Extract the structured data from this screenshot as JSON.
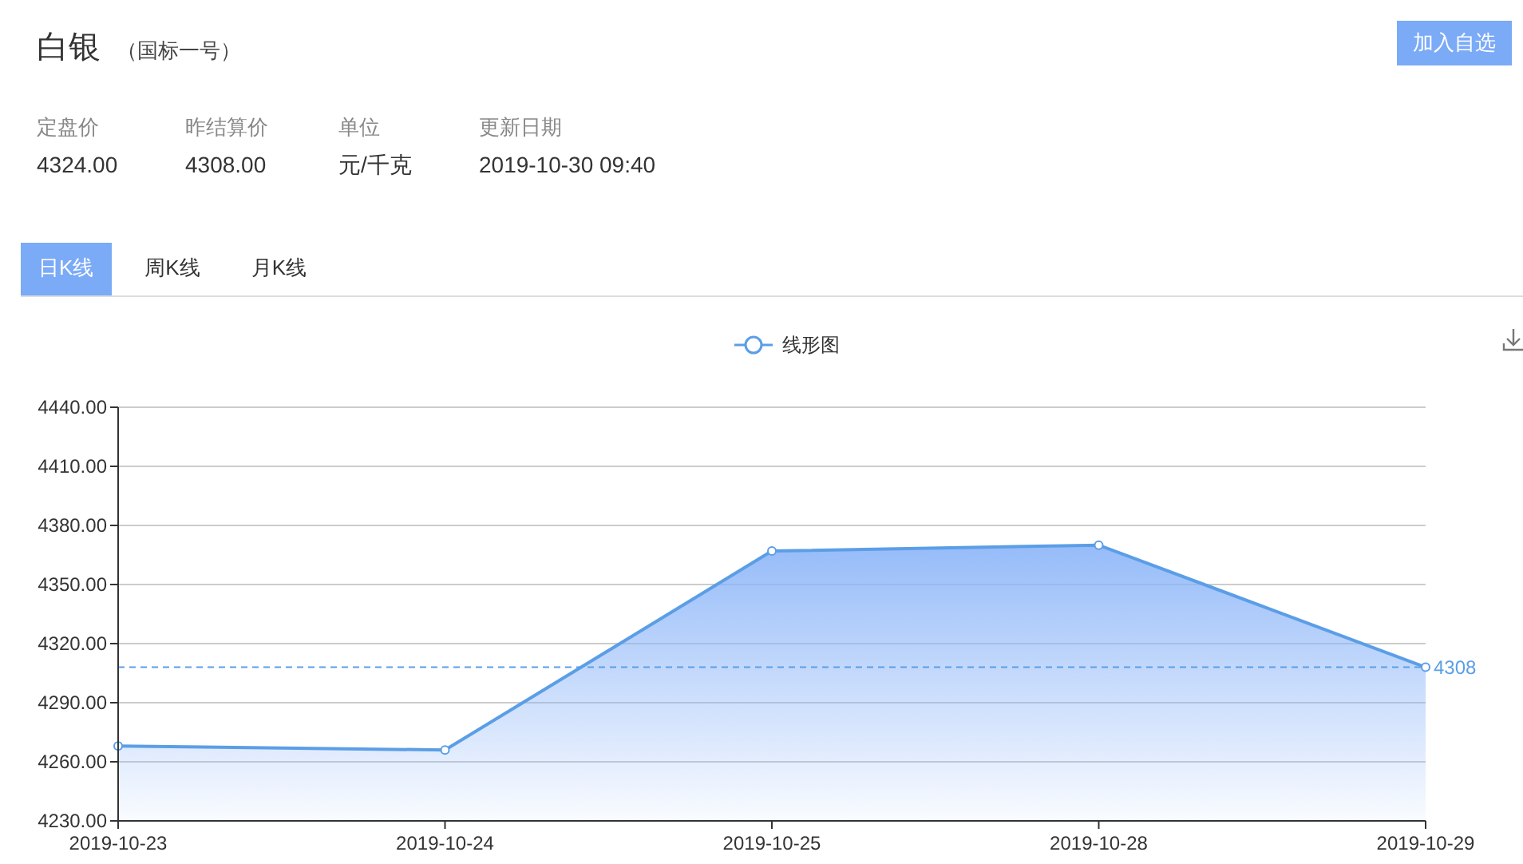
{
  "header": {
    "title": "白银",
    "subtitle": "（国标一号）",
    "add_button": "加入自选"
  },
  "info": [
    {
      "label": "定盘价",
      "value": "4324.00"
    },
    {
      "label": "昨结算价",
      "value": "4308.00"
    },
    {
      "label": "单位",
      "value": "元/千克"
    },
    {
      "label": "更新日期",
      "value": "2019-10-30 09:40"
    }
  ],
  "tabs": [
    {
      "label": "日K线",
      "selected": true
    },
    {
      "label": "周K线",
      "selected": false
    },
    {
      "label": "月K线",
      "selected": false
    }
  ],
  "chart": {
    "chart_data": {
      "type": "area",
      "categories": [
        "2019-10-23",
        "2019-10-24",
        "2019-10-25",
        "2019-10-28",
        "2019-10-29"
      ],
      "series": [
        {
          "name": "线形图",
          "color": "#5b9ee6",
          "values": [
            4268,
            4266,
            4367,
            4370,
            4308
          ]
        }
      ],
      "ylim": [
        4230,
        4440
      ],
      "yticks": [
        {
          "value": 4230,
          "label": "4230.00"
        },
        {
          "value": 4260,
          "label": "4260.00"
        },
        {
          "value": 4290,
          "label": "4290.00"
        },
        {
          "value": 4320,
          "label": "4320.00"
        },
        {
          "value": 4350,
          "label": "4350.00"
        },
        {
          "value": 4380,
          "label": "4380.00"
        },
        {
          "value": 4410,
          "label": "4410.00"
        },
        {
          "value": 4440,
          "label": "4440.00"
        }
      ],
      "grid": true,
      "ref_lines": [
        {
          "axis": "y",
          "value": 4308,
          "label": "4308",
          "color": "#5b9ee6"
        }
      ]
    }
  }
}
